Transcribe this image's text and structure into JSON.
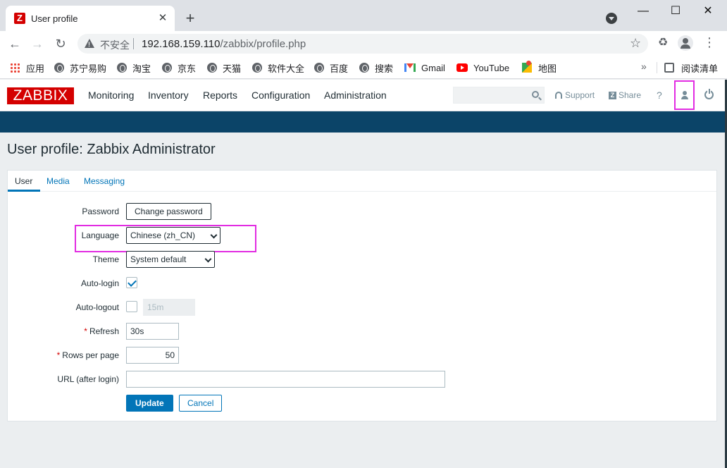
{
  "browser": {
    "tab_title": "User profile",
    "tab_favicon_letter": "Z",
    "new_tab": "+",
    "tab_close": "✕",
    "insecure_label": "不安全",
    "url_host": "192.168.159.110",
    "url_path": "/zabbix/profile.php",
    "bookmarks": [
      {
        "label": "应用",
        "icon": "apps-grid-icon"
      },
      {
        "label": "苏宁易购",
        "icon": "globe-icon"
      },
      {
        "label": "淘宝",
        "icon": "globe-icon"
      },
      {
        "label": "京东",
        "icon": "globe-icon"
      },
      {
        "label": "天猫",
        "icon": "globe-icon"
      },
      {
        "label": "软件大全",
        "icon": "globe-icon"
      },
      {
        "label": "百度",
        "icon": "globe-icon"
      },
      {
        "label": "搜索",
        "icon": "globe-icon"
      },
      {
        "label": "Gmail",
        "icon": "gmail-icon"
      },
      {
        "label": "YouTube",
        "icon": "youtube-icon"
      },
      {
        "label": "地图",
        "icon": "maps-icon"
      }
    ],
    "bookmarks_more": "»",
    "reading_list": "阅读清单"
  },
  "zabbix": {
    "logo": "ZABBIX",
    "menu": [
      "Monitoring",
      "Inventory",
      "Reports",
      "Configuration",
      "Administration"
    ],
    "support_label": "Support",
    "share_label": "Share",
    "share_icon_letter": "Z",
    "help_label": "?",
    "accent_color": "#0275b8",
    "header_bar_color": "#0b4468",
    "brand_color": "#d40000"
  },
  "page": {
    "title": "User profile: Zabbix Administrator"
  },
  "tabs": [
    "User",
    "Media",
    "Messaging"
  ],
  "form": {
    "password_label": "Password",
    "change_password_button": "Change password",
    "language_label": "Language",
    "language_value": "Chinese (zh_CN)",
    "theme_label": "Theme",
    "theme_value": "System default",
    "autologin_label": "Auto-login",
    "autologin_checked": true,
    "autologout_label": "Auto-logout",
    "autologout_checked": false,
    "autologout_value": "15m",
    "refresh_label": "Refresh",
    "refresh_value": "30s",
    "rows_per_page_label": "Rows per page",
    "rows_per_page_value": "50",
    "url_label": "URL (after login)",
    "url_value": "",
    "required_marker": "*",
    "update_button": "Update",
    "cancel_button": "Cancel"
  },
  "annotation_color": "#e22ce2"
}
